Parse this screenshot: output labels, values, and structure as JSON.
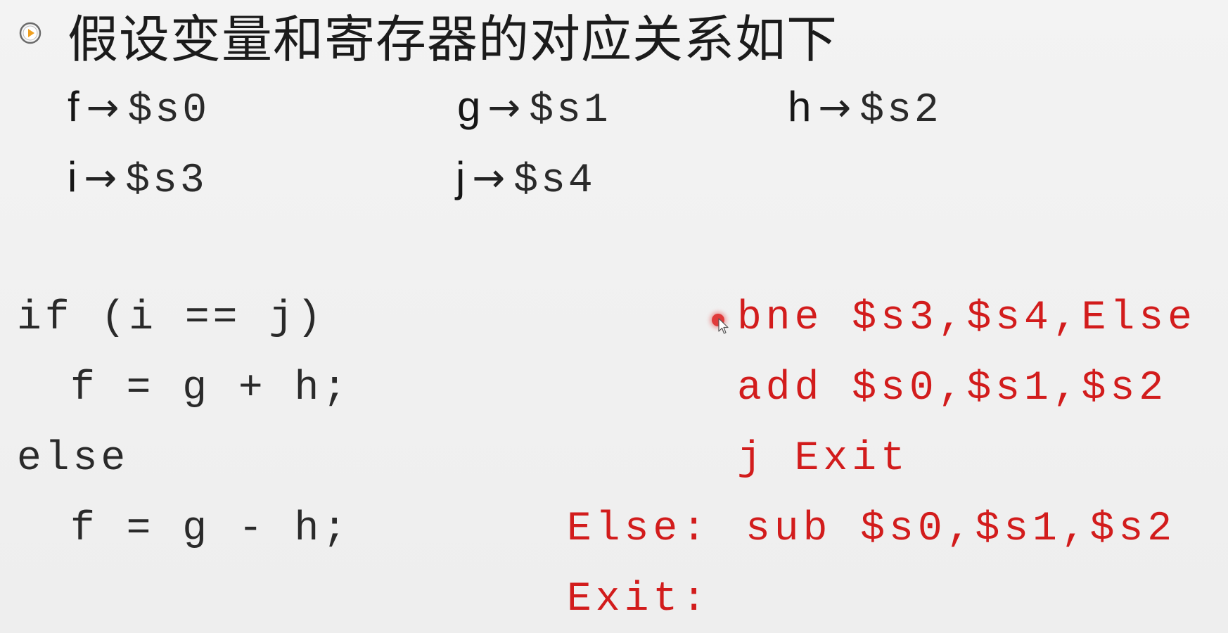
{
  "title": "假设变量和寄存器的对应关系如下",
  "mappings": {
    "f": {
      "var": "f",
      "arrow": "→",
      "reg": "$s0"
    },
    "g": {
      "var": "g",
      "arrow": "→",
      "reg": "$s1"
    },
    "h": {
      "var": "h",
      "arrow": "→",
      "reg": "$s2"
    },
    "i": {
      "var": "i",
      "arrow": "→",
      "reg": "$s3"
    },
    "j": {
      "var": "j",
      "arrow": "→",
      "reg": "$s4"
    }
  },
  "c_code": {
    "line1": "if (i == j)",
    "line2": "f = g + h;",
    "line3": "else",
    "line4": "f = g - h;"
  },
  "assembly": {
    "line1": "bne $s3,$s4,Else",
    "line2": "add $s0,$s1,$s2",
    "line3": "j Exit",
    "line4_label": "Else:",
    "line4": "sub $s0,$s1,$s2",
    "line5": "Exit:"
  },
  "colors": {
    "assembly": "#d21c1c",
    "text": "#2a2a2a",
    "background": "#f1f1f1",
    "bullet_accent": "#f0a020"
  },
  "icons": {
    "bullet": "play-circle-icon",
    "cursor": "mouse-pointer-icon"
  }
}
